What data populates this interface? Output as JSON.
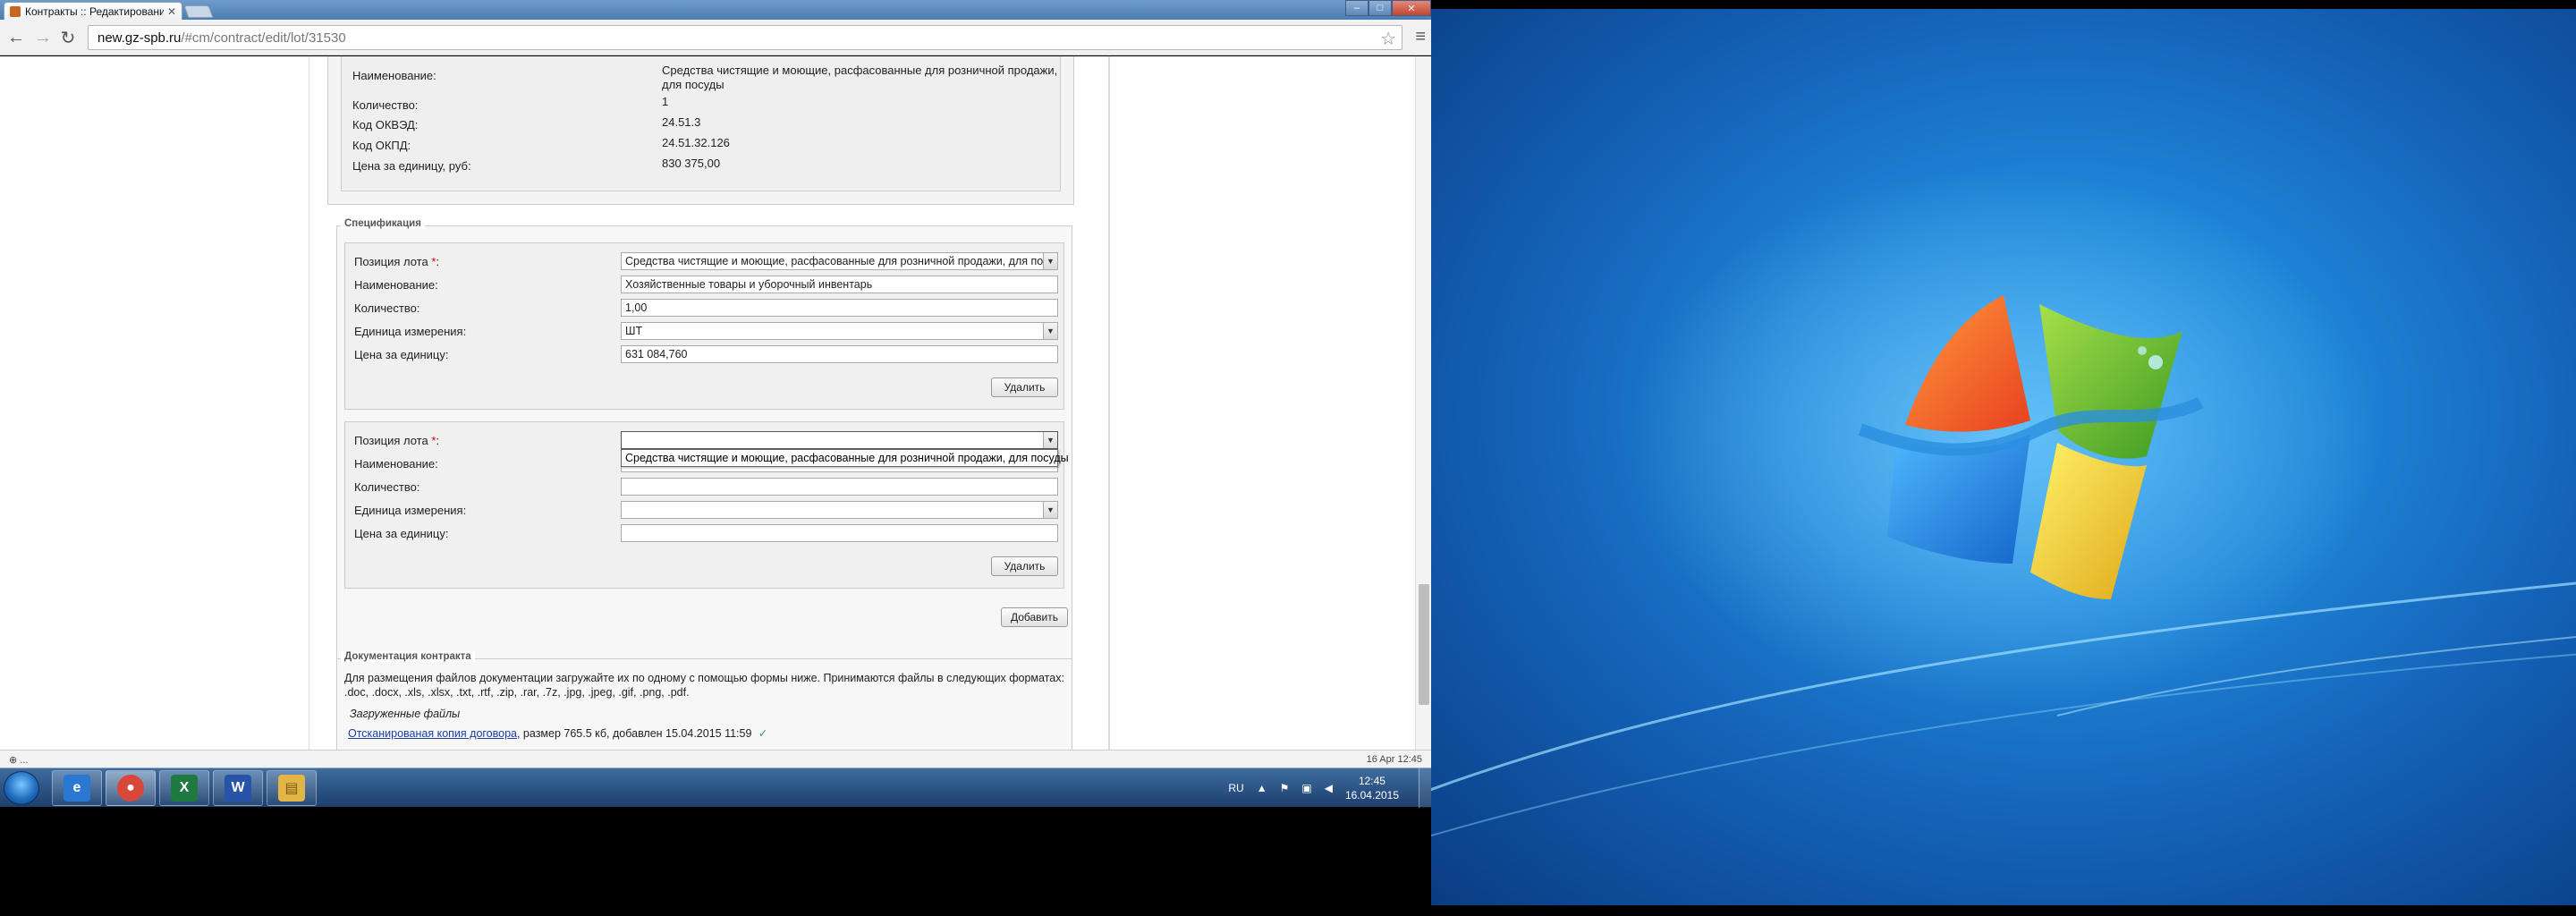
{
  "browser": {
    "tab_title": "Контракты :: Редактирование",
    "tab_close": "✕",
    "url_domain": "new.gz-spb.ru",
    "url_path": "/#cm/contract/edit/lot/31530",
    "window_controls": [
      "–",
      "□",
      "✕"
    ]
  },
  "lot_info": {
    "rows": [
      {
        "label": "Наименование:",
        "value": "Средства чистящие и моющие, расфасованные для розничной продажи,"
      },
      {
        "label": "Количество:",
        "value": "1"
      },
      {
        "label": "Код ОКВЭД:",
        "value": "24.51.3"
      },
      {
        "label": "Код ОКПД:",
        "value": "24.51.32.126"
      },
      {
        "label": "Цена за единицу, руб:",
        "value": "830 375,00"
      }
    ],
    "name_continuation": "для посуды"
  },
  "specification": {
    "legend": "Спецификация",
    "item1": {
      "position_label": "Позиция лота",
      "required_mark": "*",
      "position_suffix": ":",
      "position_value": "Средства чистящие и моющие, расфасованные для розничной продажи, для посуды",
      "name_label": "Наименование:",
      "name_value": "Хозяйственные товары и уборочный инвентарь",
      "qty_label": "Количество:",
      "qty_value": "1,00",
      "unit_label": "Единица измерения:",
      "unit_value": "ШТ",
      "price_label": "Цена за единицу:",
      "price_value": "631 084,760",
      "delete_label": "Удалить"
    },
    "item2": {
      "position_label": "Позиция лота",
      "required_mark": "*",
      "position_suffix": ":",
      "position_value": "",
      "dropdown_option": "Средства чистящие и моющие, расфасованные для розничной продажи, для посуды",
      "name_label": "Наименование:",
      "qty_label": "Количество:",
      "unit_label": "Единица измерения:",
      "price_label": "Цена за единицу:",
      "delete_label": "Удалить"
    },
    "add_label": "Добавить"
  },
  "documents": {
    "legend": "Документация контракта",
    "description_line1": "Для размещения файлов документации загружайте их по одному с помощью формы ниже. Принимаются файлы в следующих форматах:",
    "description_line2": ".doc, .docx, .xls, .xlsx, .txt, .rtf, .zip, .rar, .7z, .jpg, .jpeg, .gif, .png, .pdf.",
    "uploaded_title": "Загруженные файлы",
    "file_link": "Отсканированая копия договора",
    "file_meta": ", размер 765.5 кб, добавлен 15.04.2015 11:59"
  },
  "statusbar": {
    "left": "⊕ ...",
    "right": "16 Apr 12:45"
  },
  "taskbar": {
    "apps": [
      {
        "name": "ie",
        "icon": "e",
        "color": "#2a78d2"
      },
      {
        "name": "chrome",
        "icon": "●",
        "color": "#d8473a"
      },
      {
        "name": "excel",
        "icon": "X",
        "color": "#1e7a3e"
      },
      {
        "name": "word",
        "icon": "W",
        "color": "#2753a8"
      },
      {
        "name": "explorer",
        "icon": "▤",
        "color": "#e3b547"
      }
    ],
    "lang": "RU",
    "time": "12:45",
    "date": "16.04.2015"
  }
}
